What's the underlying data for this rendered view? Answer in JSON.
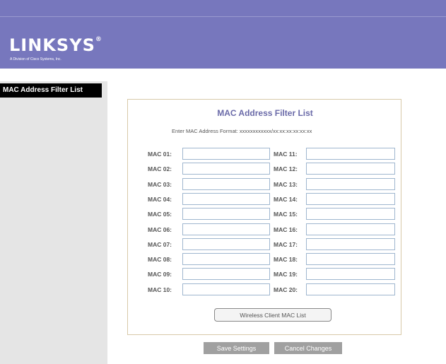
{
  "header": {
    "brand_name": "LINKSYS",
    "brand_mark": "®",
    "brand_subtitle": "A Division of Cisco Systems, Inc."
  },
  "nav": {
    "active_item": "MAC Address Filter List"
  },
  "panel": {
    "title": "MAC Address Filter List",
    "format_hint": "Enter MAC Address Format: xxxxxxxxxxxx/xx:xx:xx:xx:xx:xx"
  },
  "mac_entries": [
    {
      "label": "MAC 01:",
      "value": ""
    },
    {
      "label": "MAC 02:",
      "value": ""
    },
    {
      "label": "MAC 03:",
      "value": ""
    },
    {
      "label": "MAC 04:",
      "value": ""
    },
    {
      "label": "MAC 05:",
      "value": ""
    },
    {
      "label": "MAC 06:",
      "value": ""
    },
    {
      "label": "MAC 07:",
      "value": ""
    },
    {
      "label": "MAC 08:",
      "value": ""
    },
    {
      "label": "MAC 09:",
      "value": ""
    },
    {
      "label": "MAC 10:",
      "value": ""
    },
    {
      "label": "MAC 11:",
      "value": ""
    },
    {
      "label": "MAC 12:",
      "value": ""
    },
    {
      "label": "MAC 13:",
      "value": ""
    },
    {
      "label": "MAC 14:",
      "value": ""
    },
    {
      "label": "MAC 15:",
      "value": ""
    },
    {
      "label": "MAC 16:",
      "value": ""
    },
    {
      "label": "MAC 17:",
      "value": ""
    },
    {
      "label": "MAC 18:",
      "value": ""
    },
    {
      "label": "MAC 19:",
      "value": ""
    },
    {
      "label": "MAC 20:",
      "value": ""
    }
  ],
  "buttons": {
    "wireless_client_list": "Wireless Client MAC List",
    "save": "Save Settings",
    "cancel": "Cancel Changes"
  },
  "colors": {
    "header_bg": "#7777bd",
    "sidebar_bg": "#e5e5e5",
    "nav_active_bg": "#000000",
    "title_text": "#6a6aa8",
    "input_border": "#9fb6cf",
    "action_button_bg": "#a0a0a0"
  }
}
